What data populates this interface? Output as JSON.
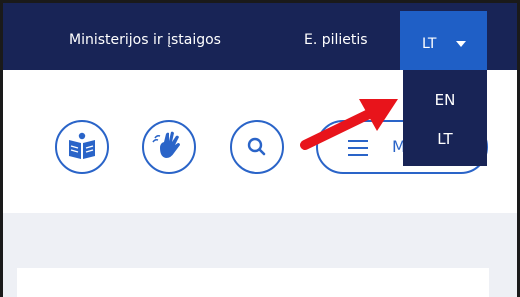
{
  "nav": {
    "links": [
      "Ministerijos ir įstaigos",
      "E. pilietis"
    ],
    "lang_current": "LT",
    "accent_color": "#1f5fc6",
    "background_color": "#182456"
  },
  "lang_menu": {
    "options": [
      "EN",
      "LT"
    ]
  },
  "toolbar": {
    "icons": [
      "easy-read-icon",
      "sign-language-icon",
      "search-icon",
      "menu-icon"
    ],
    "menu_label_visible": "M"
  },
  "annotation": {
    "arrow_color": "#e8141b"
  }
}
